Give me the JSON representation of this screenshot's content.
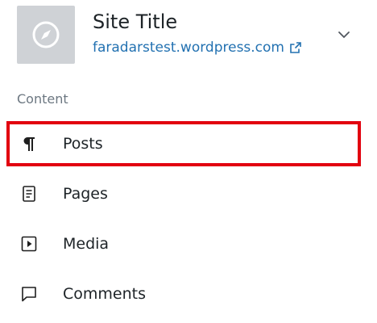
{
  "site": {
    "title": "Site Title",
    "url": "faradarstest.wordpress.com"
  },
  "section": {
    "label": "Content"
  },
  "menu": {
    "items": [
      {
        "label": "Posts",
        "icon": "pilcrow-icon",
        "selected": true
      },
      {
        "label": "Pages",
        "icon": "page-icon",
        "selected": false
      },
      {
        "label": "Media",
        "icon": "media-icon",
        "selected": false
      },
      {
        "label": "Comments",
        "icon": "comment-icon",
        "selected": false
      }
    ]
  },
  "colors": {
    "accent_link": "#2271b1",
    "highlight_border": "#e2000f",
    "site_icon_bg": "#cfd2d6",
    "muted_text": "#6c7781"
  }
}
